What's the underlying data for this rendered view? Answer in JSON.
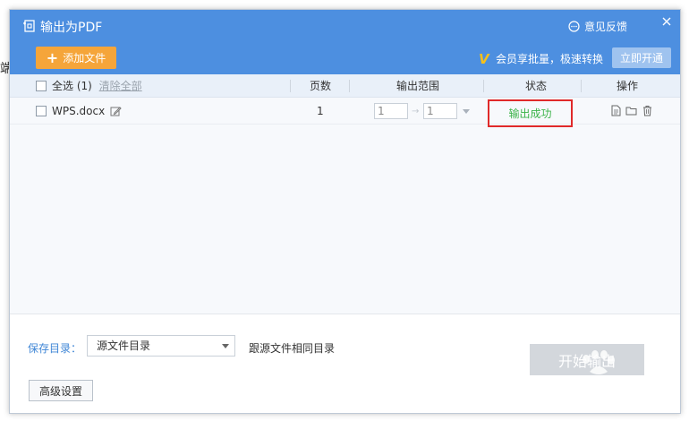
{
  "background_text": "端",
  "window": {
    "title": "输出为PDF",
    "feedback_label": "意见反馈"
  },
  "toolbar": {
    "add_file_label": "添加文件",
    "vip_text": "会员享批量，极速转换",
    "open_vip_label": "立即开通"
  },
  "table": {
    "select_all_label": "全选",
    "count_label": "(1)",
    "clear_all_label": "清除全部",
    "columns": {
      "pages": "页数",
      "range": "输出范围",
      "status": "状态",
      "actions": "操作"
    },
    "rows": [
      {
        "name": "WPS.docx",
        "pages": "1",
        "range_from": "1",
        "range_to": "1",
        "status": "输出成功"
      }
    ]
  },
  "footer": {
    "save_dir_label": "保存目录：",
    "save_dir_value": "源文件目录",
    "save_dir_hint": "跟源文件相同目录",
    "start_label": "开始输出",
    "advanced_label": "高级设置"
  },
  "colors": {
    "header_bg": "#4d8fe0",
    "add_button": "#f5a53a",
    "status_success": "#3bb349",
    "highlight_box": "#e02a2a"
  },
  "icons": [
    "pdf-export-icon",
    "feedback-icon",
    "close-icon",
    "vip-v-icon",
    "edit-icon",
    "file-icon",
    "folder-icon",
    "trash-icon",
    "chevron-down-icon"
  ]
}
